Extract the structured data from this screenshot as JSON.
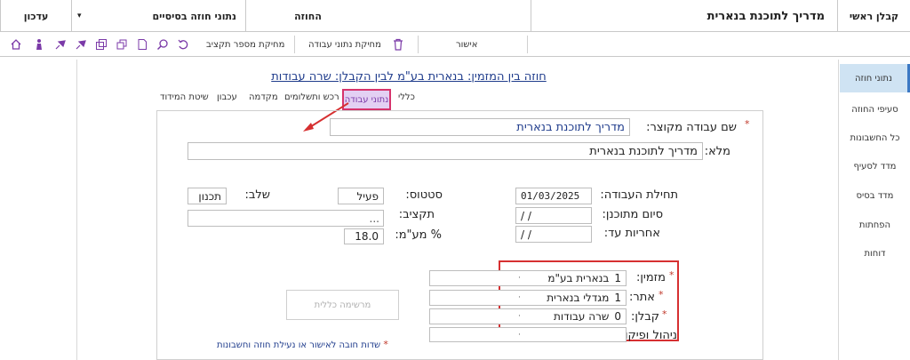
{
  "header": {
    "role": "קבלן ראשי",
    "project": "מדריך לתוכנת בנארית",
    "section": "החוזה",
    "data_dropdown": "נתוני חוזה בסיסיים",
    "update": "עדכון",
    "dropdown_arrow": "▾"
  },
  "toolbar": {
    "approve": "אישור",
    "delete_work_data": "מחיקת נתוני עבודה",
    "delete_budget_number": "מחיקת מספר תקציב"
  },
  "sidebar": {
    "items": [
      {
        "label": "נתוני חוזה"
      },
      {
        "label": "סעיפי החוזה"
      },
      {
        "label": "כל החשבונות"
      },
      {
        "label": "מדד לסעיף"
      },
      {
        "label": "מדד בסיס"
      },
      {
        "label": "הפחתות"
      },
      {
        "label": "דוחות"
      }
    ]
  },
  "page_title": "חוזה בין המזמין: בנארית בע\"מ  לבין הקבלן: שרה עבודות",
  "tabs": [
    {
      "label": "כללי"
    },
    {
      "label": "נתוני עבודה"
    },
    {
      "label": "רכש ותשלומים"
    },
    {
      "label": "מקדמה"
    },
    {
      "label": "עכבון"
    },
    {
      "label": "שיטת המידוד"
    }
  ],
  "form": {
    "short_name_label": "שם עבודה מקוצר:",
    "short_name_value": "מדריך לתוכנת בנארית",
    "full_label": "מלא:",
    "full_value": "מדריך לתוכנת בנארית",
    "start_label": "תחילת העבודה:",
    "start_value": "01/03/2025",
    "planned_end_label": "סיום מתוכנן:",
    "planned_end_value": "/    /",
    "warranty_label": "אחריות עד:",
    "warranty_value": "/    /",
    "status_label": "סטטוס:",
    "status_value": "פעיל",
    "stage_label": "שלב:",
    "stage_value": "תכנון",
    "budget_label": "תקציב:",
    "budget_btn": "...",
    "vat_label": "% מע\"מ:",
    "vat_value": "18.0",
    "client_label": "מזמין:",
    "client_num": "1",
    "client_value": "בנארית בע\"מ",
    "site_label": "אתר:",
    "site_num": "1",
    "site_value": "מגדלי בנארית",
    "contractor_label": "קבלן:",
    "contractor_num": "0",
    "contractor_value": "שרה עבודות",
    "supervision_label": "ניהול ופיקוח:",
    "general_list_btn": "מרשימה כללית",
    "required_note": "שדות חובה לאישור או נעילת חוזה וחשבונות",
    "required_mark": "*",
    "dd_mark": "·"
  },
  "colors": {
    "accent": "#7b3aa8",
    "highlight": "#d6336c",
    "title": "#1f3c8c"
  }
}
